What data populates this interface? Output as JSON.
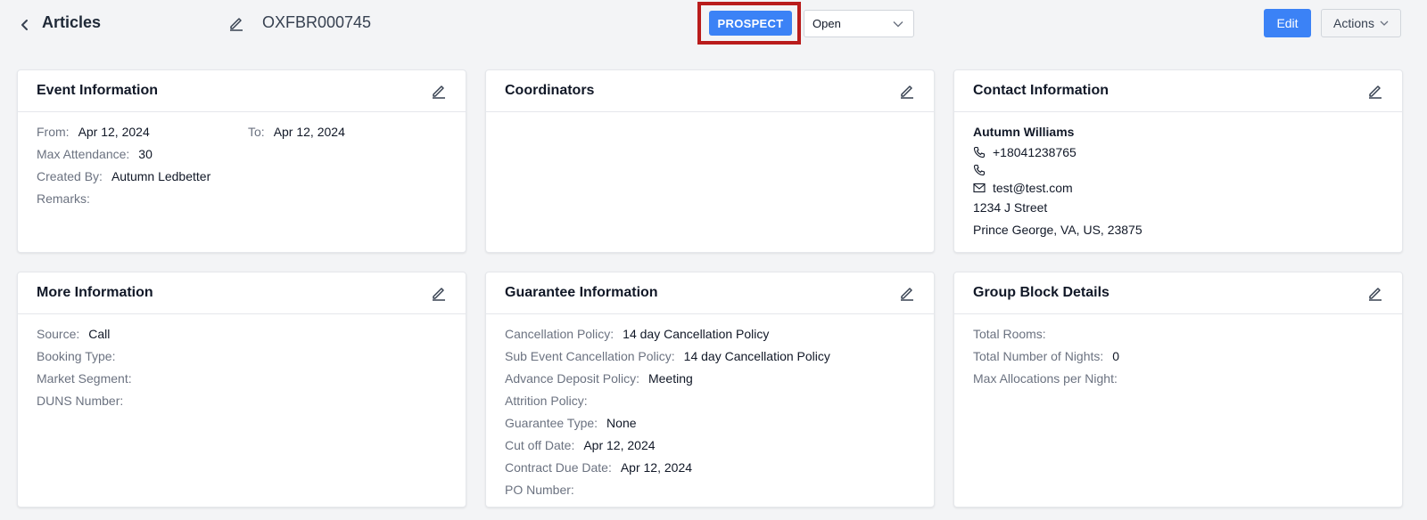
{
  "header": {
    "title": "Articles",
    "record_id": "OXFBR000745",
    "status_label": "PROSPECT",
    "status_select": "Open",
    "edit_label": "Edit",
    "actions_label": "Actions"
  },
  "event_info": {
    "title": "Event Information",
    "from_label": "From:",
    "from_value": "Apr 12, 2024",
    "to_label": "To:",
    "to_value": "Apr 12, 2024",
    "max_label": "Max Attendance:",
    "max_value": "30",
    "created_label": "Created By:",
    "created_value": "Autumn Ledbetter",
    "remarks_label": "Remarks:"
  },
  "coordinators": {
    "title": "Coordinators"
  },
  "contact": {
    "title": "Contact Information",
    "name": "Autumn Williams",
    "phone": "+18041238765",
    "email": "test@test.com",
    "address1": "1234 J Street",
    "address2": "Prince George, VA, US, 23875"
  },
  "more_info": {
    "title": "More Information",
    "source_label": "Source:",
    "source_value": "Call",
    "booking_label": "Booking Type:",
    "market_label": "Market Segment:",
    "duns_label": "DUNS Number:"
  },
  "guarantee": {
    "title": "Guarantee Information",
    "cancel_label": "Cancellation Policy:",
    "cancel_value": "14 day Cancellation Policy",
    "sub_cancel_label": "Sub Event Cancellation Policy:",
    "sub_cancel_value": "14 day Cancellation Policy",
    "deposit_label": "Advance Deposit Policy:",
    "deposit_value": "Meeting",
    "attrition_label": "Attrition Policy:",
    "type_label": "Guarantee Type:",
    "type_value": "None",
    "cutoff_label": "Cut off Date:",
    "cutoff_value": "Apr 12, 2024",
    "contract_label": "Contract Due Date:",
    "contract_value": "Apr 12, 2024",
    "po_label": "PO Number:"
  },
  "group_block": {
    "title": "Group Block Details",
    "rooms_label": "Total Rooms:",
    "nights_label": "Total Number of Nights:",
    "nights_value": "0",
    "alloc_label": "Max Allocations per Night:"
  },
  "icons": {
    "back": "chevron-left-icon",
    "edit": "pencil-icon",
    "dropdown": "chevron-down-icon",
    "phone": "phone-icon",
    "email": "envelope-icon"
  },
  "colors": {
    "primary": "#3b82f6",
    "highlight": "#b91c1c",
    "background": "#f3f4f6"
  }
}
